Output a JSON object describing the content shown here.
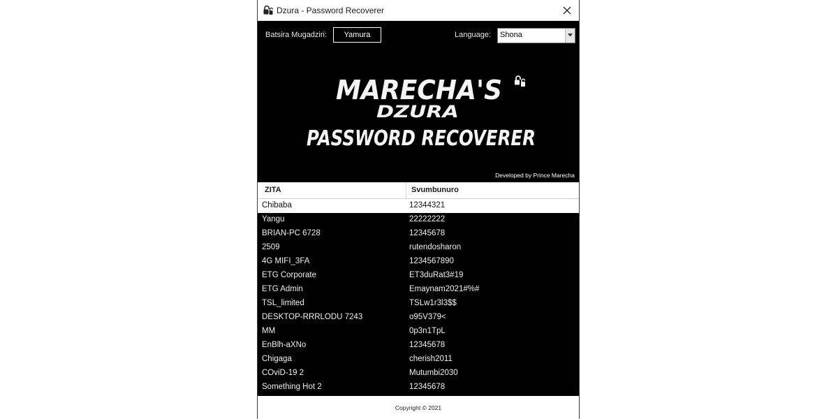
{
  "window": {
    "title": "Dzura - Password Recoverer",
    "icon": "padlock-icon",
    "close_icon": "close-icon"
  },
  "controls": {
    "user_label": "Batsira Mugadziri:",
    "user_button": "Yamura",
    "language_label": "Language:",
    "language_selected": "Shona"
  },
  "logo": {
    "line1": "MARECHA'S",
    "line2": "DZURA",
    "line3": "PASSWORD RECOVERER",
    "credit": "Developed by Prince Marecha"
  },
  "table": {
    "headers": [
      "ZITA",
      "Svumbunuro"
    ],
    "rows": [
      [
        "Chibaba",
        "12344321"
      ],
      [
        "Yangu",
        "22222222"
      ],
      [
        "BRIAN-PC 6728",
        "12345678"
      ],
      [
        "2509",
        "rutendosharon"
      ],
      [
        "4G MIFI_3FA",
        "1234567890"
      ],
      [
        "ETG Corporate",
        "ET3duRat3#19"
      ],
      [
        "ETG Admin",
        "Emaynam2021#%#"
      ],
      [
        "TSL_limited",
        "TSLw1r3l3$$"
      ],
      [
        "DESKTOP-RRRLODU 7243",
        "o95V379<"
      ],
      [
        "MM",
        "0p3n1TpL"
      ],
      [
        "EnBlh-aXNo",
        "12345678"
      ],
      [
        "Chigaga",
        "cherish2011"
      ],
      [
        "COviD-19 2",
        "Mutumbi2030"
      ],
      [
        "Something Hot 2",
        "12345678"
      ]
    ],
    "selected_row": 0
  },
  "footer": {
    "copyright": "Copyright © 2021"
  },
  "colors": {
    "background": "#000000",
    "text": "#f0f0f0",
    "selected_row": "#ffffff"
  }
}
